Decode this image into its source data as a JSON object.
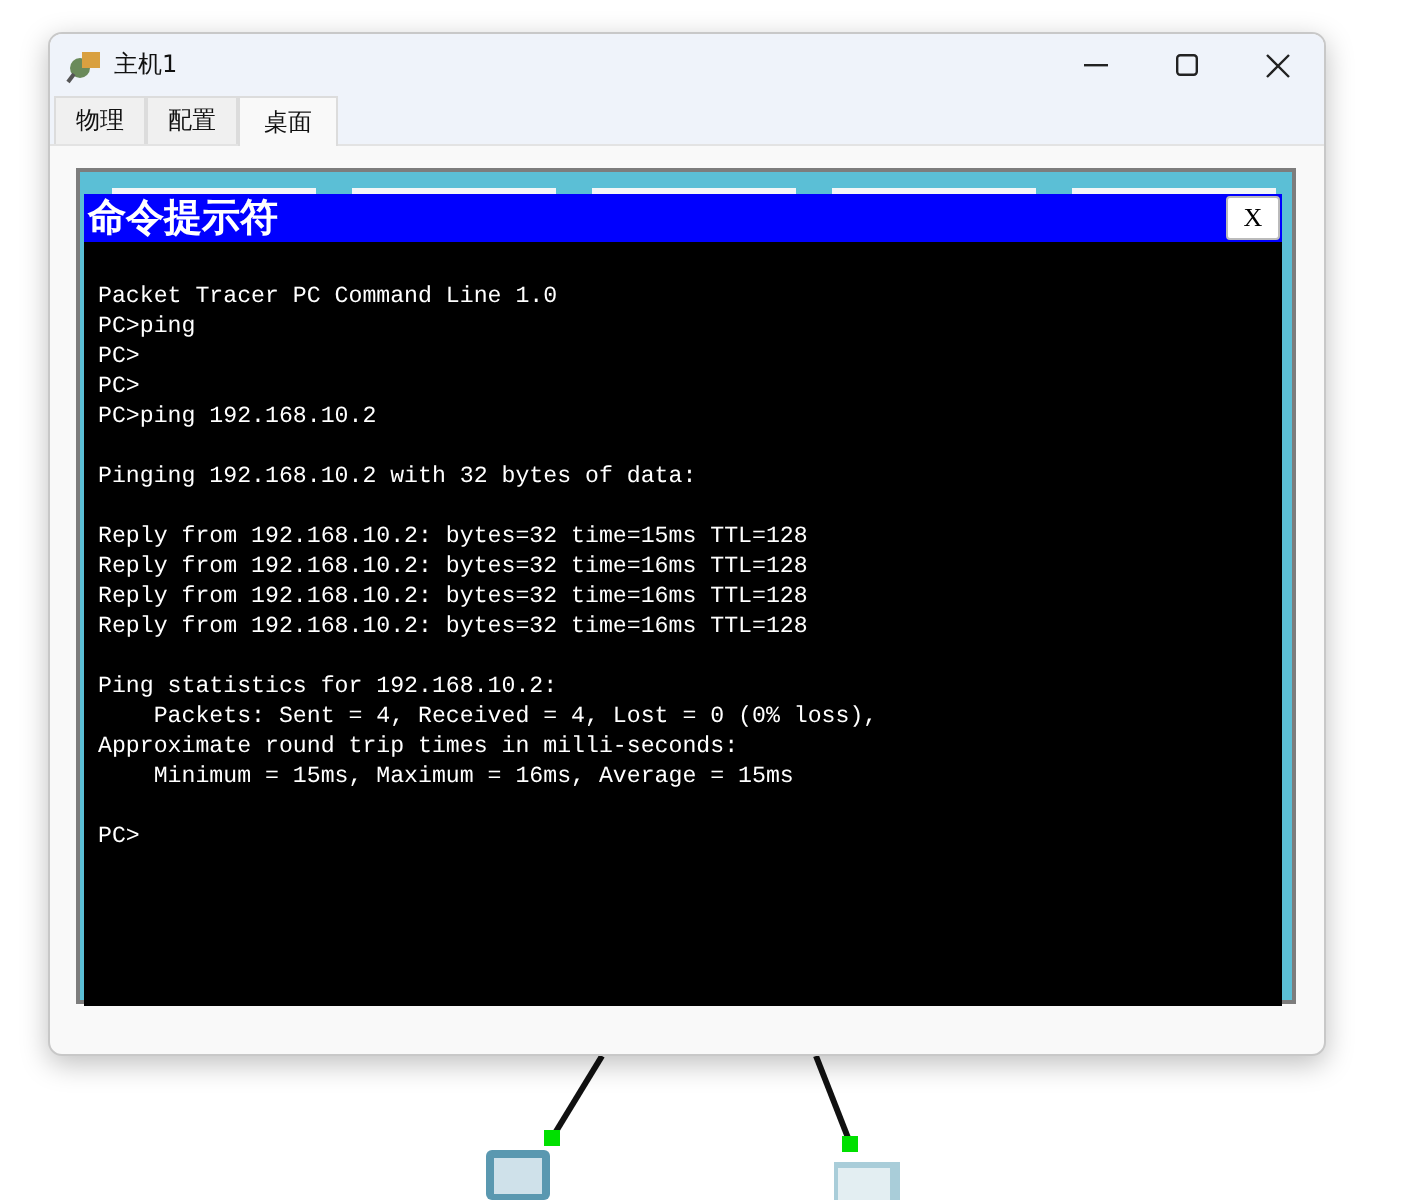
{
  "window": {
    "title": "主机1"
  },
  "tabs": [
    {
      "label": "物理",
      "selected": false
    },
    {
      "label": "配置",
      "selected": false
    },
    {
      "label": "桌面",
      "selected": true
    }
  ],
  "terminal": {
    "title": "命令提示符",
    "close": "X",
    "blocks": [
      [
        "Packet Tracer PC Command Line 1.0",
        "PC>ping",
        "PC>",
        "PC>",
        "PC>ping 192.168.10.2"
      ],
      [
        "Pinging 192.168.10.2 with 32 bytes of data:"
      ],
      [
        "Reply from 192.168.10.2: bytes=32 time=15ms TTL=128",
        "Reply from 192.168.10.2: bytes=32 time=16ms TTL=128",
        "Reply from 192.168.10.2: bytes=32 time=16ms TTL=128",
        "Reply from 192.168.10.2: bytes=32 time=16ms TTL=128"
      ],
      [
        "Ping statistics for 192.168.10.2:",
        "    Packets: Sent = 4, Received = 4, Lost = 0 (0% loss),",
        "Approximate round trip times in milli-seconds:",
        "    Minimum = 15ms, Maximum = 16ms, Average = 15ms"
      ],
      [
        "PC>"
      ]
    ]
  }
}
